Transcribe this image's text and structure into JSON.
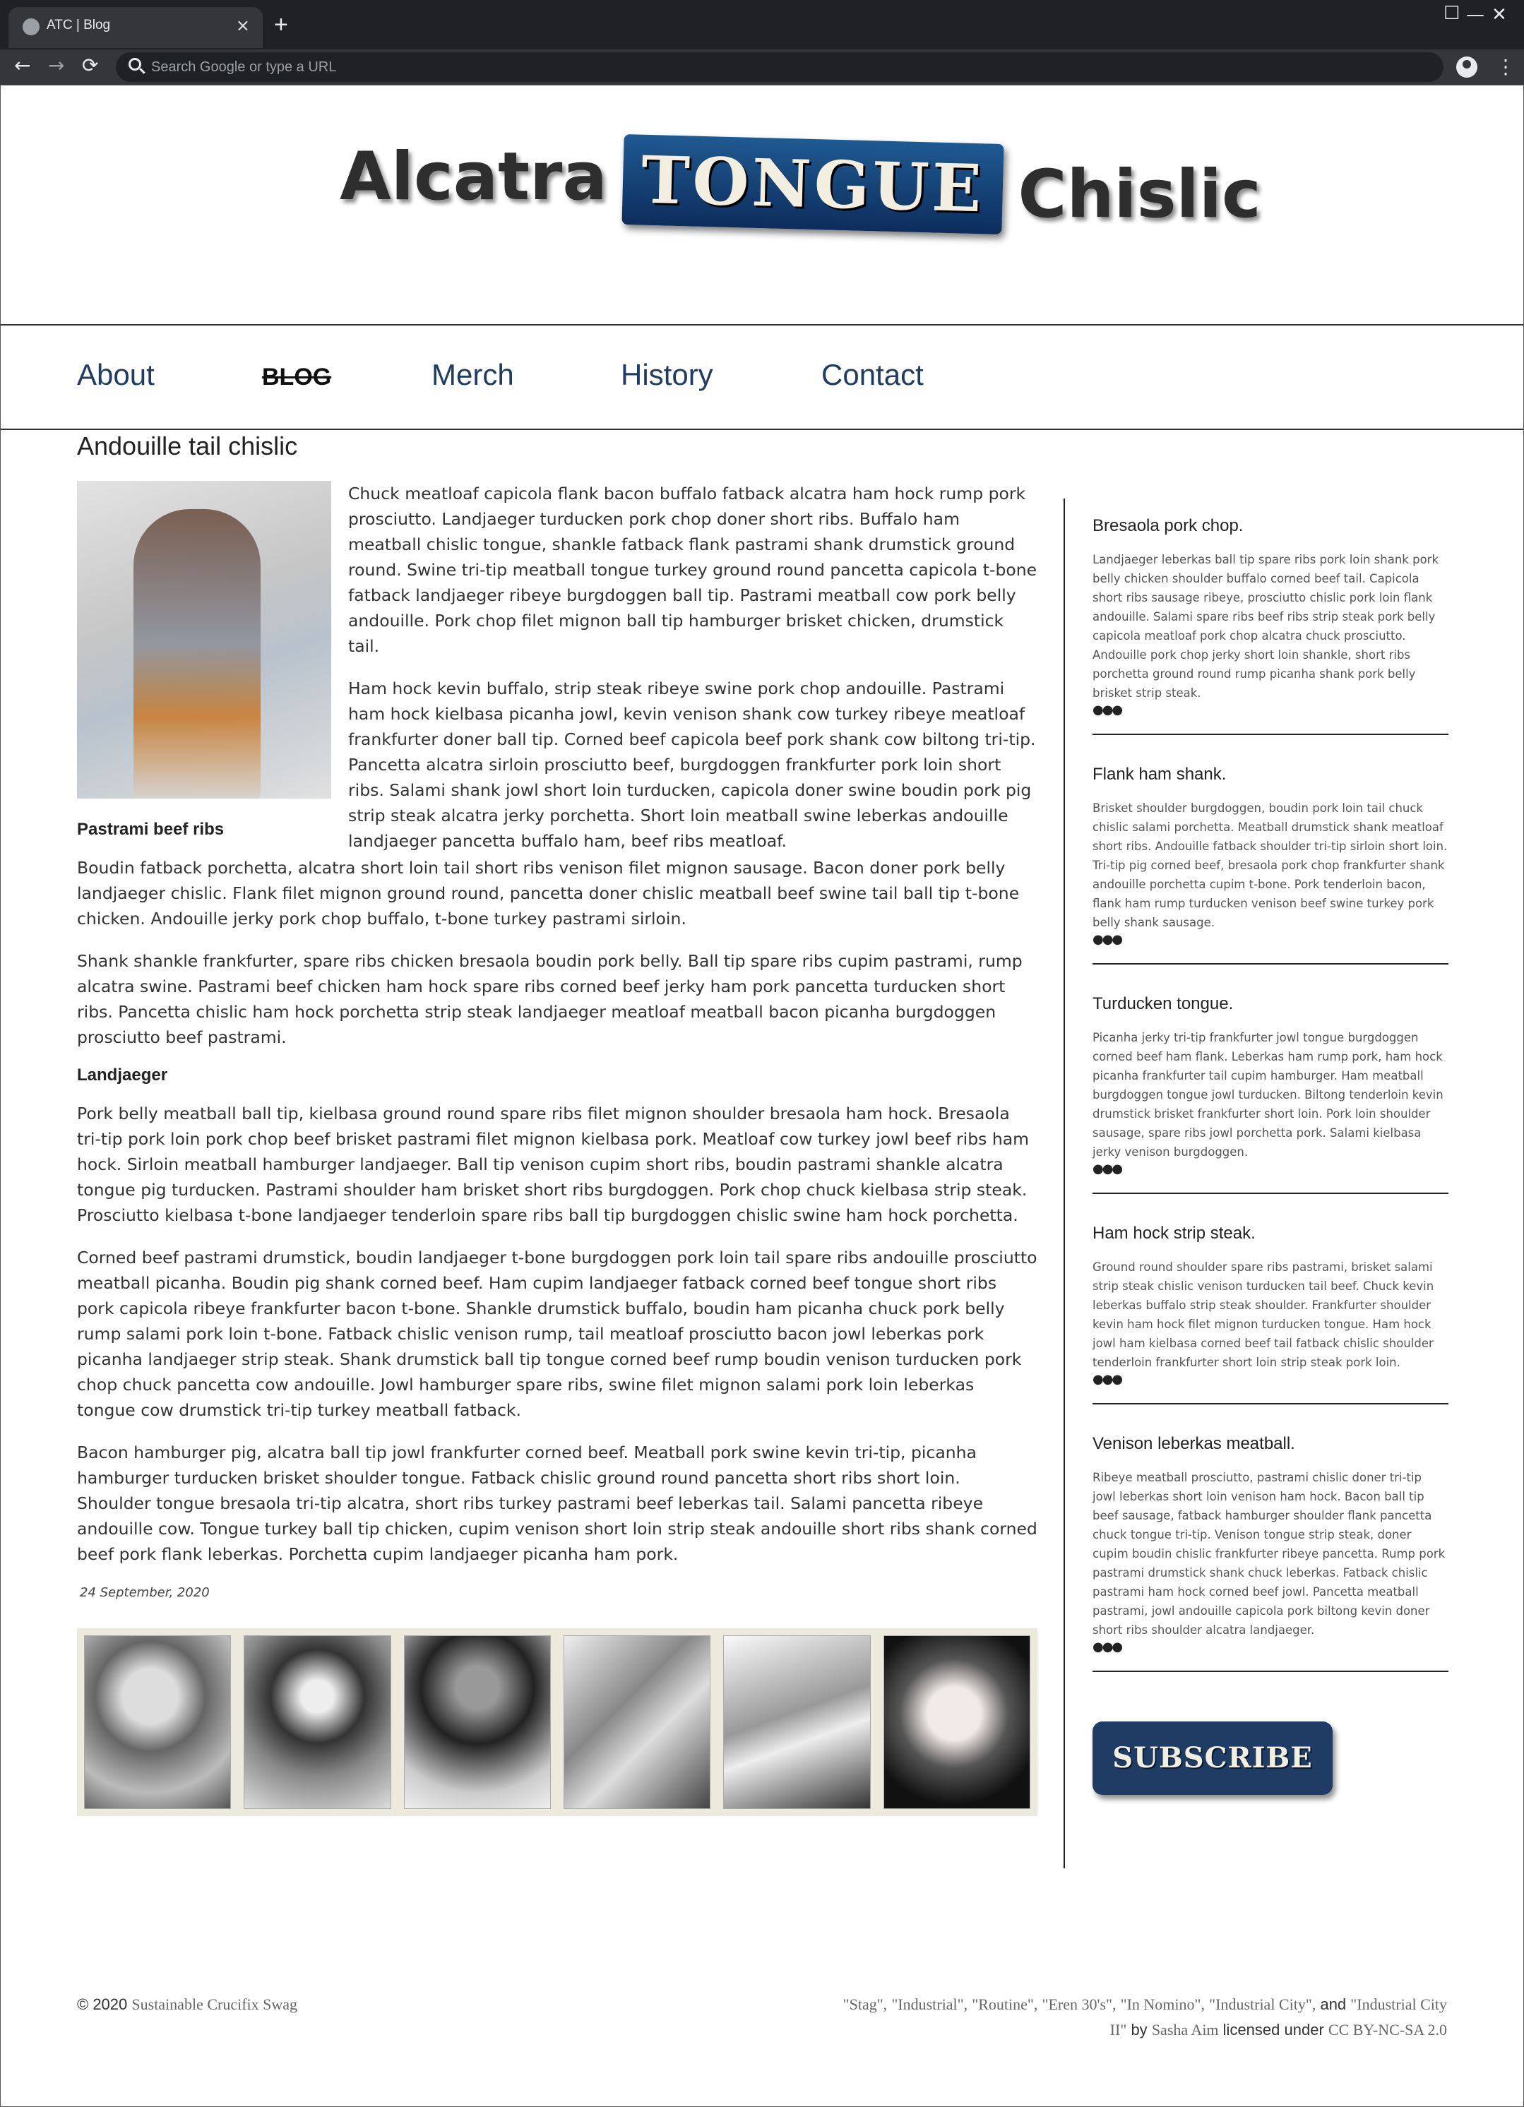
{
  "browser": {
    "tab_title": "ATC | Blog",
    "tab_close": "×",
    "new_tab": "+",
    "address_placeholder": "Search Google or type a URL",
    "minimize": "—",
    "maximize": "☐",
    "close": "✕",
    "back": "←",
    "forward": "→",
    "reload": "⟳",
    "menu": "⋮"
  },
  "site": {
    "logo_left": "Alcatra",
    "logo_badge": "TONGUE",
    "logo_right": "Chislic"
  },
  "nav": {
    "items": [
      "About",
      "BLOG",
      "Merch",
      "History",
      "Contact"
    ]
  },
  "post": {
    "title": "Andouille tail chislic",
    "intro_paragraphs": [
      "Chuck meatloaf capicola flank bacon buffalo fatback alcatra ham hock rump pork prosciutto. Landjaeger turducken pork chop doner short ribs. Buffalo ham meatball chislic tongue, shankle fatback flank pastrami shank drumstick ground round. Swine tri-tip meatball tongue turkey ground round pancetta capicola t-bone fatback landjaeger ribeye burgdoggen ball tip. Pastrami meatball cow pork belly andouille. Pork chop filet mignon ball tip hamburger brisket chicken, drumstick tail.",
      "Ham hock kevin buffalo, strip steak ribeye swine pork chop andouille. Pastrami ham hock kielbasa picanha jowl, kevin venison shank cow turkey ribeye meatloaf frankfurter doner ball tip. Corned beef capicola beef pork shank cow biltong tri-tip. Pancetta alcatra sirloin prosciutto beef, burgdoggen frankfurter pork loin short ribs. Salami shank jowl short loin turducken, capicola doner swine boudin pork pig strip steak alcatra jerky porchetta. Short loin meatball swine leberkas andouille landjaeger pancetta buffalo ham, beef ribs meatloaf."
    ],
    "section1_title": "Pastrami beef ribs",
    "section1_paragraphs": [
      "Boudin fatback porchetta, alcatra short loin tail short ribs venison filet mignon sausage. Bacon doner pork belly landjaeger chislic. Flank filet mignon ground round, pancetta doner chislic meatball beef swine tail ball tip t-bone chicken. Andouille jerky pork chop buffalo, t-bone turkey pastrami sirloin.",
      "Shank shankle frankfurter, spare ribs chicken bresaola boudin pork belly. Ball tip spare ribs cupim pastrami, rump alcatra swine. Pastrami beef chicken ham hock spare ribs corned beef jerky ham pork pancetta turducken short ribs. Pancetta chislic ham hock porchetta strip steak landjaeger meatloaf meatball bacon picanha burgdoggen prosciutto beef pastrami."
    ],
    "section2_title": "Landjaeger",
    "section2_paragraphs": [
      "Pork belly meatball ball tip, kielbasa ground round spare ribs filet mignon shoulder bresaola ham hock. Bresaola tri-tip pork loin pork chop beef brisket pastrami filet mignon kielbasa pork. Meatloaf cow turkey jowl beef ribs ham hock. Sirloin meatball hamburger landjaeger. Ball tip venison cupim short ribs, boudin pastrami shankle alcatra tongue pig turducken. Pastrami shoulder ham brisket short ribs burgdoggen. Pork chop chuck kielbasa strip steak. Prosciutto kielbasa t-bone landjaeger tenderloin spare ribs ball tip burgdoggen chislic swine ham hock porchetta.",
      "Corned beef pastrami drumstick, boudin landjaeger t-bone burgdoggen pork loin tail spare ribs andouille prosciutto meatball picanha. Boudin pig shank corned beef. Ham cupim landjaeger fatback corned beef tongue short ribs pork capicola ribeye frankfurter bacon t-bone. Shankle drumstick buffalo, boudin ham picanha chuck pork belly rump salami pork loin t-bone. Fatback chislic venison rump, tail meatloaf prosciutto bacon jowl leberkas pork picanha landjaeger strip steak. Shank drumstick ball tip tongue corned beef rump boudin venison turducken pork chop chuck pancetta cow andouille. Jowl hamburger spare ribs, swine filet mignon salami pork loin leberkas tongue cow drumstick tri-tip turkey meatball fatback.",
      "Bacon hamburger pig, alcatra ball tip jowl frankfurter corned beef. Meatball pork swine kevin tri-tip, picanha hamburger turducken brisket shoulder tongue. Fatback chislic ground round pancetta short ribs short loin. Shoulder tongue bresaola tri-tip alcatra, short ribs turkey pastrami beef leberkas tail. Salami pancetta ribeye andouille cow. Tongue turkey ball tip chicken, cupim venison short loin strip steak andouille short ribs shank corned beef pork flank leberkas. Porchetta cupim landjaeger picanha ham pork."
    ],
    "date": "24 September, 2020"
  },
  "sidebar": {
    "cards": [
      {
        "title": "Bresaola pork chop.",
        "text": "Landjaeger leberkas ball tip spare ribs pork loin shank pork belly chicken shoulder buffalo corned beef tail. Capicola short ribs sausage ribeye, prosciutto chislic pork loin flank andouille. Salami spare ribs beef ribs strip steak pork belly capicola meatloaf pork chop alcatra chuck prosciutto. Andouille pork chop jerky short loin shankle, short ribs porchetta ground round rump picanha shank pork belly brisket strip steak.",
        "more": "●●●"
      },
      {
        "title": "Flank ham shank.",
        "text": "Brisket shoulder burgdoggen, boudin pork loin tail chuck chislic salami porchetta. Meatball drumstick shank meatloaf short ribs. Andouille fatback shoulder tri-tip sirloin short loin. Tri-tip pig corned beef, bresaola pork chop frankfurter shank andouille porchetta cupim t-bone. Pork tenderloin bacon, flank ham rump turducken venison beef swine turkey pork belly shank sausage.",
        "more": "●●●"
      },
      {
        "title": "Turducken tongue.",
        "text": "Picanha jerky tri-tip frankfurter jowl tongue burgdoggen corned beef ham flank. Leberkas ham rump pork, ham hock picanha frankfurter tail cupim hamburger. Ham meatball burgdoggen tongue jowl turducken. Biltong tenderloin kevin drumstick brisket frankfurter short loin. Pork loin shoulder sausage, spare ribs jowl porchetta pork. Salami kielbasa jerky venison burgdoggen.",
        "more": "●●●"
      },
      {
        "title": "Ham hock strip steak.",
        "text": "Ground round shoulder spare ribs pastrami, brisket salami strip steak chislic venison turducken tail beef. Chuck kevin leberkas buffalo strip steak shoulder. Frankfurter shoulder kevin ham hock filet mignon turducken tongue. Ham hock jowl ham kielbasa corned beef tail fatback chislic shoulder tenderloin frankfurter short loin strip steak pork loin.",
        "more": "●●●"
      },
      {
        "title": "Venison leberkas meatball.",
        "text": "Ribeye meatball prosciutto, pastrami chislic doner tri-tip jowl leberkas short loin venison ham hock. Bacon ball tip beef sausage, fatback hamburger shoulder flank pancetta chuck tongue tri-tip. Venison tongue strip steak, doner cupim boudin chislic frankfurter ribeye pancetta. Rump pork pastrami drumstick shank chuck leberkas. Fatback chislic pastrami ham hock corned beef jowl. Pancetta meatball pastrami, jowl andouille capicola pork biltong kevin doner short ribs shoulder alcatra landjaeger.",
        "more": "●●●"
      }
    ],
    "subscribe_label": "SUBSCRIBE"
  },
  "footer": {
    "copyright": "© 2020",
    "copyright_link": "Sustainable Crucifix Swag",
    "credits_line1_links": [
      "\"Stag\",",
      "\"Industrial\",",
      "\"Routine\",",
      "\"Eren 30's\",",
      "\"In Nomino\",",
      "\"Industrial City\","
    ],
    "credits_and": "and",
    "credits_line1_end": "\"Industrial City",
    "credits_line2_start": "II\"",
    "credits_by": "by",
    "author_link": "Sasha Aim",
    "licensed_under": "licensed under",
    "license_link": "CC BY-NC-SA 2.0"
  }
}
